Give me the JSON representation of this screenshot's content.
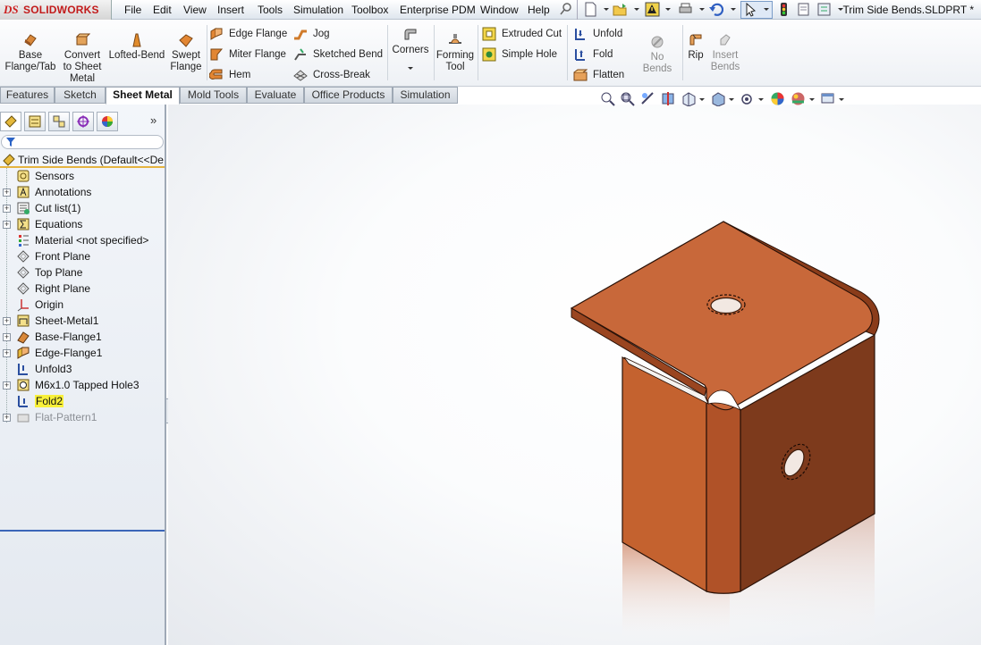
{
  "app": {
    "logo_ds": "DS",
    "logo_name": "SOLIDWORKS",
    "document_title": "Trim Side Bends.SLDPRT *"
  },
  "menu": [
    "File",
    "Edit",
    "View",
    "Insert",
    "Tools",
    "Simulation",
    "Toolbox",
    "Enterprise PDM",
    "Window",
    "Help"
  ],
  "ribbon": {
    "base_flange": "Base Flange/Tab",
    "base_flange_lines": [
      "Base",
      "Flange/Tab"
    ],
    "convert_lines": [
      "Convert",
      "to Sheet",
      "Metal"
    ],
    "lofted_bend": "Lofted-Bend",
    "swept_flange_lines": [
      "Swept",
      "Flange"
    ],
    "edge_flange": "Edge Flange",
    "miter_flange": "Miter Flange",
    "hem": "Hem",
    "jog": "Jog",
    "sketched_bend": "Sketched Bend",
    "cross_break": "Cross-Break",
    "corners": "Corners",
    "forming_tool_lines": [
      "Forming",
      "Tool"
    ],
    "extruded_cut": "Extruded Cut",
    "simple_hole": "Simple Hole",
    "unfold": "Unfold",
    "fold": "Fold",
    "flatten": "Flatten",
    "no_bends": "No Bends",
    "rip": "Rip",
    "insert_bends_lines": [
      "Insert",
      "Bends"
    ]
  },
  "tabs": [
    {
      "label": "Features",
      "active": false
    },
    {
      "label": "Sketch",
      "active": false
    },
    {
      "label": "Sheet Metal",
      "active": true
    },
    {
      "label": "Mold Tools",
      "active": false
    },
    {
      "label": "Evaluate",
      "active": false
    },
    {
      "label": "Office Products",
      "active": false
    },
    {
      "label": "Simulation",
      "active": false
    }
  ],
  "feature_tree": {
    "root": "Trim Side Bends  (Default<<De",
    "expand_glyph": "»",
    "items": [
      {
        "label": "Sensors",
        "icon": "sensor-icon",
        "expandable": false
      },
      {
        "label": "Annotations",
        "icon": "annotations-icon",
        "expandable": true
      },
      {
        "label": "Cut list(1)",
        "icon": "cut-list-icon",
        "expandable": true
      },
      {
        "label": "Equations",
        "icon": "equations-icon",
        "expandable": true
      },
      {
        "label": "Material <not specified>",
        "icon": "material-icon",
        "expandable": false
      },
      {
        "label": "Front Plane",
        "icon": "plane-icon",
        "expandable": false
      },
      {
        "label": "Top Plane",
        "icon": "plane-icon",
        "expandable": false
      },
      {
        "label": "Right Plane",
        "icon": "plane-icon",
        "expandable": false
      },
      {
        "label": "Origin",
        "icon": "origin-icon",
        "expandable": false
      },
      {
        "label": "Sheet-Metal1",
        "icon": "sheet-metal-icon",
        "expandable": true
      },
      {
        "label": "Base-Flange1",
        "icon": "base-flange-icon",
        "expandable": true
      },
      {
        "label": "Edge-Flange1",
        "icon": "edge-flange-icon",
        "expandable": true
      },
      {
        "label": "Unfold3",
        "icon": "unfold-icon",
        "expandable": false
      },
      {
        "label": "M6x1.0 Tapped Hole3",
        "icon": "hole-icon",
        "expandable": true
      },
      {
        "label": "Fold2",
        "icon": "fold-icon",
        "expandable": false,
        "highlighted": true
      },
      {
        "label": "Flat-Pattern1",
        "icon": "flat-pattern-icon",
        "expandable": true,
        "suppressed": true
      }
    ]
  },
  "colors": {
    "part_face_light": "#c8683a",
    "part_face_dark": "#7a3519",
    "part_face_mid": "#a34a22",
    "highlight": "#f8f03a"
  }
}
